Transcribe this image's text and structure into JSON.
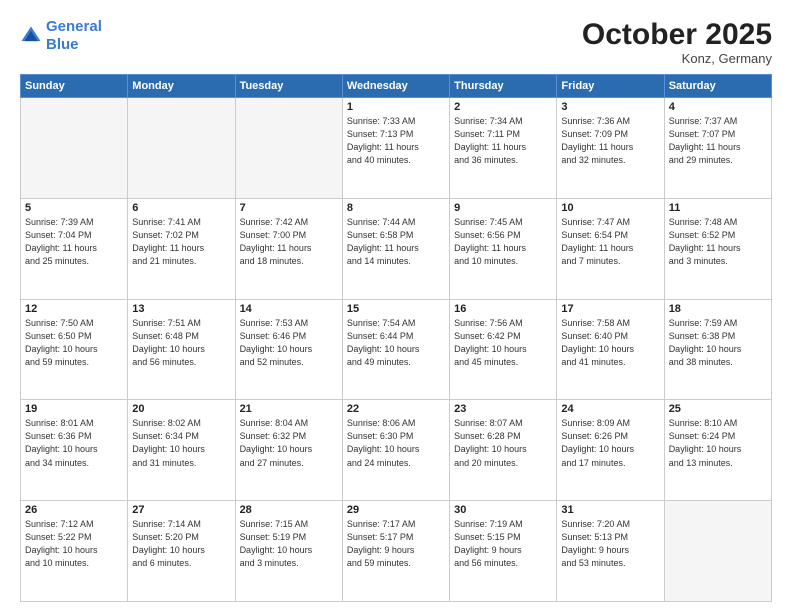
{
  "logo": {
    "line1": "General",
    "line2": "Blue"
  },
  "title": "October 2025",
  "subtitle": "Konz, Germany",
  "days_header": [
    "Sunday",
    "Monday",
    "Tuesday",
    "Wednesday",
    "Thursday",
    "Friday",
    "Saturday"
  ],
  "weeks": [
    [
      {
        "num": "",
        "info": ""
      },
      {
        "num": "",
        "info": ""
      },
      {
        "num": "",
        "info": ""
      },
      {
        "num": "1",
        "info": "Sunrise: 7:33 AM\nSunset: 7:13 PM\nDaylight: 11 hours\nand 40 minutes."
      },
      {
        "num": "2",
        "info": "Sunrise: 7:34 AM\nSunset: 7:11 PM\nDaylight: 11 hours\nand 36 minutes."
      },
      {
        "num": "3",
        "info": "Sunrise: 7:36 AM\nSunset: 7:09 PM\nDaylight: 11 hours\nand 32 minutes."
      },
      {
        "num": "4",
        "info": "Sunrise: 7:37 AM\nSunset: 7:07 PM\nDaylight: 11 hours\nand 29 minutes."
      }
    ],
    [
      {
        "num": "5",
        "info": "Sunrise: 7:39 AM\nSunset: 7:04 PM\nDaylight: 11 hours\nand 25 minutes."
      },
      {
        "num": "6",
        "info": "Sunrise: 7:41 AM\nSunset: 7:02 PM\nDaylight: 11 hours\nand 21 minutes."
      },
      {
        "num": "7",
        "info": "Sunrise: 7:42 AM\nSunset: 7:00 PM\nDaylight: 11 hours\nand 18 minutes."
      },
      {
        "num": "8",
        "info": "Sunrise: 7:44 AM\nSunset: 6:58 PM\nDaylight: 11 hours\nand 14 minutes."
      },
      {
        "num": "9",
        "info": "Sunrise: 7:45 AM\nSunset: 6:56 PM\nDaylight: 11 hours\nand 10 minutes."
      },
      {
        "num": "10",
        "info": "Sunrise: 7:47 AM\nSunset: 6:54 PM\nDaylight: 11 hours\nand 7 minutes."
      },
      {
        "num": "11",
        "info": "Sunrise: 7:48 AM\nSunset: 6:52 PM\nDaylight: 11 hours\nand 3 minutes."
      }
    ],
    [
      {
        "num": "12",
        "info": "Sunrise: 7:50 AM\nSunset: 6:50 PM\nDaylight: 10 hours\nand 59 minutes."
      },
      {
        "num": "13",
        "info": "Sunrise: 7:51 AM\nSunset: 6:48 PM\nDaylight: 10 hours\nand 56 minutes."
      },
      {
        "num": "14",
        "info": "Sunrise: 7:53 AM\nSunset: 6:46 PM\nDaylight: 10 hours\nand 52 minutes."
      },
      {
        "num": "15",
        "info": "Sunrise: 7:54 AM\nSunset: 6:44 PM\nDaylight: 10 hours\nand 49 minutes."
      },
      {
        "num": "16",
        "info": "Sunrise: 7:56 AM\nSunset: 6:42 PM\nDaylight: 10 hours\nand 45 minutes."
      },
      {
        "num": "17",
        "info": "Sunrise: 7:58 AM\nSunset: 6:40 PM\nDaylight: 10 hours\nand 41 minutes."
      },
      {
        "num": "18",
        "info": "Sunrise: 7:59 AM\nSunset: 6:38 PM\nDaylight: 10 hours\nand 38 minutes."
      }
    ],
    [
      {
        "num": "19",
        "info": "Sunrise: 8:01 AM\nSunset: 6:36 PM\nDaylight: 10 hours\nand 34 minutes."
      },
      {
        "num": "20",
        "info": "Sunrise: 8:02 AM\nSunset: 6:34 PM\nDaylight: 10 hours\nand 31 minutes."
      },
      {
        "num": "21",
        "info": "Sunrise: 8:04 AM\nSunset: 6:32 PM\nDaylight: 10 hours\nand 27 minutes."
      },
      {
        "num": "22",
        "info": "Sunrise: 8:06 AM\nSunset: 6:30 PM\nDaylight: 10 hours\nand 24 minutes."
      },
      {
        "num": "23",
        "info": "Sunrise: 8:07 AM\nSunset: 6:28 PM\nDaylight: 10 hours\nand 20 minutes."
      },
      {
        "num": "24",
        "info": "Sunrise: 8:09 AM\nSunset: 6:26 PM\nDaylight: 10 hours\nand 17 minutes."
      },
      {
        "num": "25",
        "info": "Sunrise: 8:10 AM\nSunset: 6:24 PM\nDaylight: 10 hours\nand 13 minutes."
      }
    ],
    [
      {
        "num": "26",
        "info": "Sunrise: 7:12 AM\nSunset: 5:22 PM\nDaylight: 10 hours\nand 10 minutes."
      },
      {
        "num": "27",
        "info": "Sunrise: 7:14 AM\nSunset: 5:20 PM\nDaylight: 10 hours\nand 6 minutes."
      },
      {
        "num": "28",
        "info": "Sunrise: 7:15 AM\nSunset: 5:19 PM\nDaylight: 10 hours\nand 3 minutes."
      },
      {
        "num": "29",
        "info": "Sunrise: 7:17 AM\nSunset: 5:17 PM\nDaylight: 9 hours\nand 59 minutes."
      },
      {
        "num": "30",
        "info": "Sunrise: 7:19 AM\nSunset: 5:15 PM\nDaylight: 9 hours\nand 56 minutes."
      },
      {
        "num": "31",
        "info": "Sunrise: 7:20 AM\nSunset: 5:13 PM\nDaylight: 9 hours\nand 53 minutes."
      },
      {
        "num": "",
        "info": ""
      }
    ]
  ]
}
